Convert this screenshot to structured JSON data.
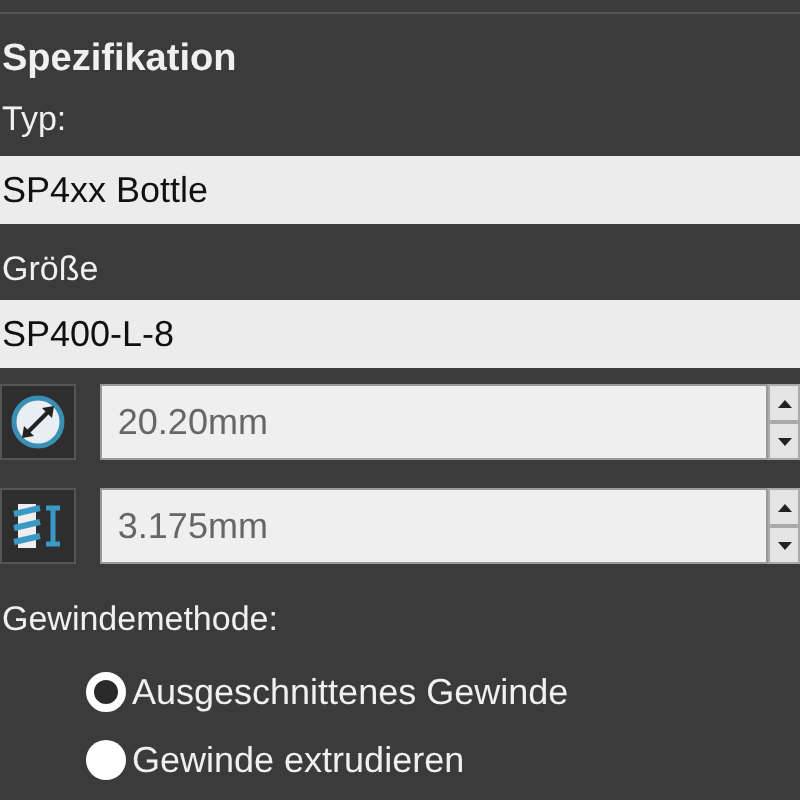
{
  "section": {
    "title": "Spezifikation"
  },
  "type_field": {
    "label": "Typ:",
    "value": "SP4xx Bottle"
  },
  "size_field": {
    "label": "Größe",
    "value": "SP400-L-8"
  },
  "spinners": [
    {
      "kind": "diameter",
      "value": "20.20mm"
    },
    {
      "kind": "pitch",
      "value": "3.175mm"
    }
  ],
  "thread_method": {
    "label": "Gewindemethode:",
    "options": [
      {
        "label": "Ausgeschnittenes Gewinde",
        "selected": true
      },
      {
        "label": "Gewinde extrudieren",
        "selected": false
      }
    ]
  }
}
